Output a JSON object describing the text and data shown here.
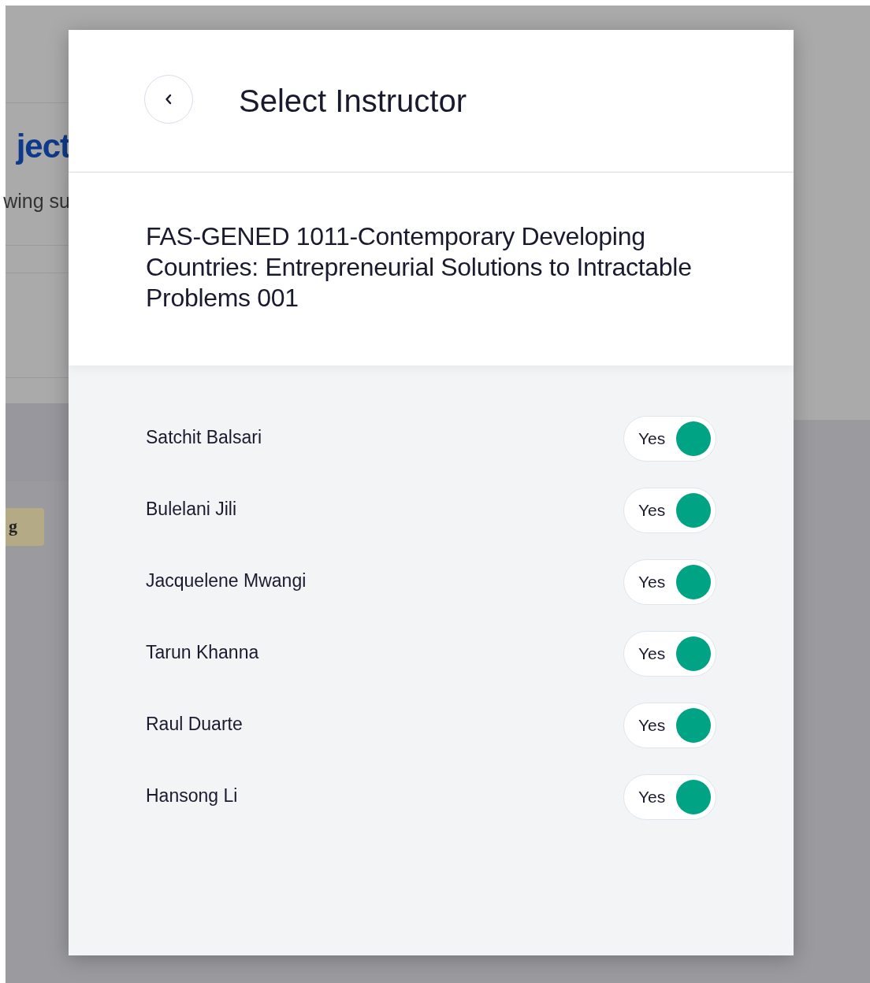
{
  "background_page": {
    "heading": "ject",
    "subtitle": "wing su",
    "tag": "g"
  },
  "modal": {
    "title": "Select Instructor",
    "course": "FAS-GENED 1011-Contemporary Developing Countries: Entrepreneurial Solutions to Intractable Problems 001",
    "instructors": [
      {
        "name": "Satchit Balsari",
        "toggle_label": "Yes",
        "on": true
      },
      {
        "name": "Bulelani Jili",
        "toggle_label": "Yes",
        "on": true
      },
      {
        "name": "Jacquelene Mwangi",
        "toggle_label": "Yes",
        "on": true
      },
      {
        "name": "Tarun Khanna",
        "toggle_label": "Yes",
        "on": true
      },
      {
        "name": "Raul Duarte",
        "toggle_label": "Yes",
        "on": true
      },
      {
        "name": "Hansong Li",
        "toggle_label": "Yes",
        "on": true
      }
    ]
  }
}
